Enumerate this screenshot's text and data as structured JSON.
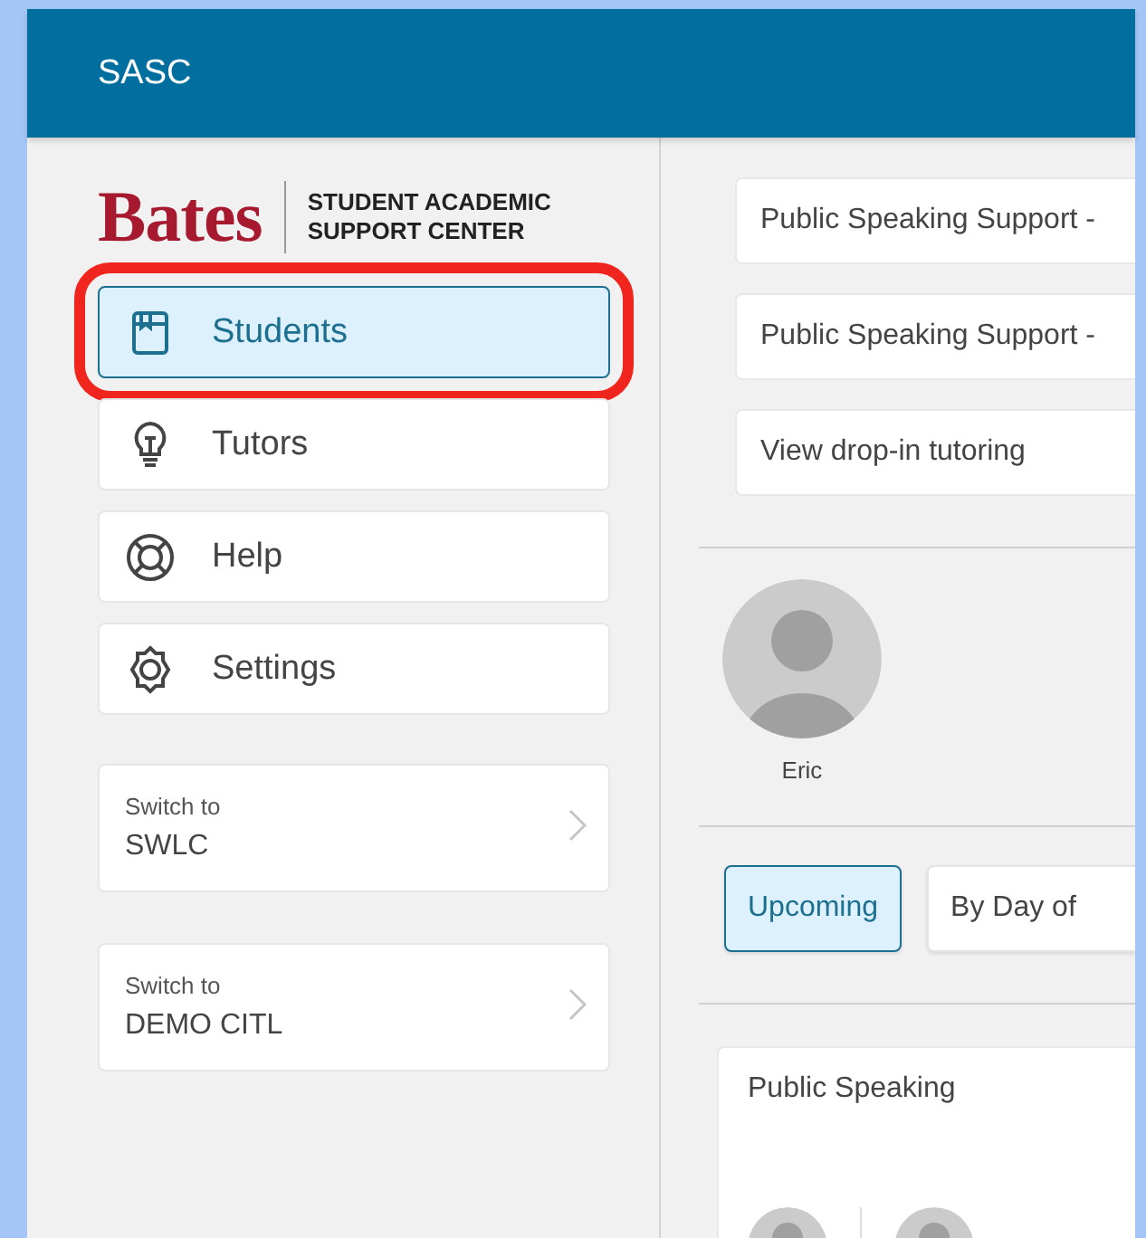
{
  "header": {
    "title": "SASC"
  },
  "logo": {
    "wordmark": "Bates",
    "tagline": [
      "STUDENT ACADEMIC",
      "SUPPORT CENTER"
    ]
  },
  "nav": [
    {
      "label": "Students",
      "kind": "book",
      "selected": true,
      "highlighted": true
    },
    {
      "label": "Tutors",
      "kind": "bulb",
      "selected": false,
      "highlighted": false
    },
    {
      "label": "Help",
      "kind": "lifebuoy",
      "selected": false,
      "highlighted": false
    },
    {
      "label": "Settings",
      "kind": "gear",
      "selected": false,
      "highlighted": false
    }
  ],
  "switch_cards": [
    {
      "caption": "Switch to",
      "target": "SWLC"
    },
    {
      "caption": "Switch to",
      "target": "DEMO CITL"
    }
  ],
  "services": [
    "Public Speaking Support -",
    "Public Speaking Support -",
    "View drop-in tutoring"
  ],
  "profile": {
    "name": "Eric"
  },
  "view_tabs": [
    {
      "label": "Upcoming",
      "selected": true
    },
    {
      "label": "By Day of",
      "selected": false
    }
  ],
  "group_card": {
    "title": "Public Speaking"
  }
}
